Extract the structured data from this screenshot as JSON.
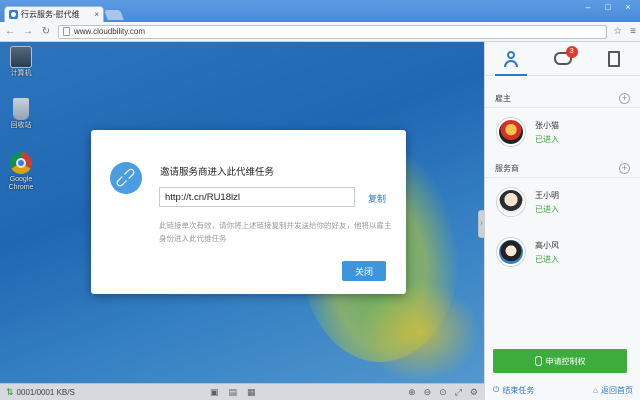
{
  "browser": {
    "tab_title": "行云服务-慰代维",
    "tab_close": "×",
    "address": "www.cloudbility.com",
    "window_controls": [
      "–",
      "□",
      "×"
    ]
  },
  "desktop": {
    "icons": [
      {
        "label": "计算机",
        "icon": "computer-icon"
      },
      {
        "label": "回收站",
        "icon": "recycle-bin-icon"
      },
      {
        "label": "Google Chrome",
        "icon": "chrome-icon"
      }
    ]
  },
  "statusbar": {
    "speed": "0001/0001 KB/S"
  },
  "sidebar": {
    "tabs": [
      {
        "icon": "person-icon",
        "active": true
      },
      {
        "icon": "chat-icon",
        "badge": "3"
      },
      {
        "icon": "clipboard-icon"
      }
    ],
    "owner_section": "雇主",
    "owner": {
      "name": "张小猫",
      "state": "已进入"
    },
    "provider_section": "服务商",
    "providers": [
      {
        "name": "王小明",
        "state": "已进入"
      },
      {
        "name": "高小风",
        "state": "已进入"
      }
    ],
    "apply_button": "申请控制权",
    "end_task": "结束任务",
    "back_home": "返回首页"
  },
  "modal": {
    "title": "邀请服务商进入此代维任务",
    "url": "http://t.cn/RU18lzl",
    "copy": "复制",
    "description": "此链接单次有效，请你将上述链接复制并发送给你的好友，他将以雇主身份进入此代维任务",
    "close": "关闭"
  },
  "colors": {
    "accent": "#2f78c4",
    "success": "#3cad3c",
    "badge": "#e23b2e"
  }
}
